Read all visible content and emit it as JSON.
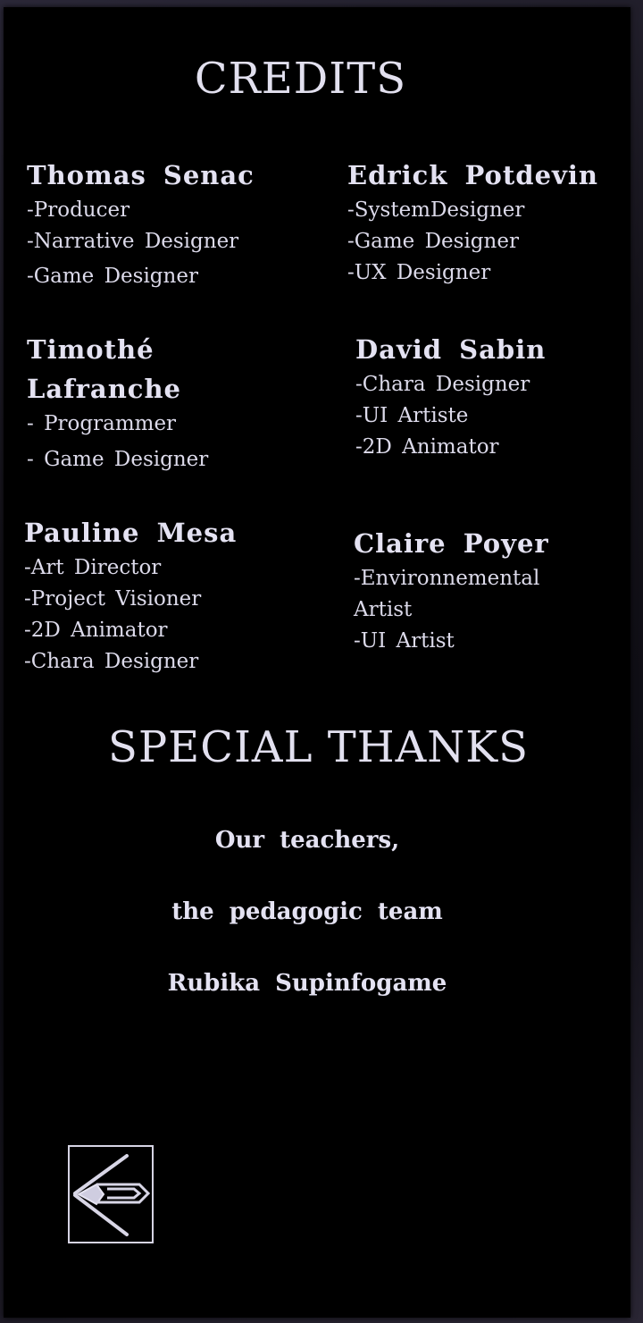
{
  "credits": {
    "title": "CREDITS",
    "members": [
      {
        "name": "Thomas Senac",
        "roles": [
          "-Producer",
          "-Narrative Designer",
          "-Game Designer"
        ]
      },
      {
        "name": "Edrick Potdevin",
        "roles": [
          "-SystemDesigner",
          "-Game Designer",
          "-UX Designer"
        ]
      },
      {
        "name": "Timothé\nLafranche",
        "roles": [
          "- Programmer",
          "- Game Designer"
        ]
      },
      {
        "name": "David Sabin",
        "roles": [
          "-Chara Designer",
          "-UI Artiste",
          "-2D Animator"
        ]
      },
      {
        "name": "Pauline Mesa",
        "roles": [
          "-Art Director",
          "-Project Visioner",
          "-2D Animator",
          "-Chara Designer"
        ]
      },
      {
        "name": "Claire Poyer",
        "roles": [
          "-Environnemental\nArtist",
          "-UI Artist"
        ]
      }
    ]
  },
  "special_thanks": {
    "title": "SPECIAL THANKS",
    "lines": [
      "Our teachers,",
      "the pedagogic team",
      "Rubika Supinfogame"
    ]
  },
  "back_button": {
    "icon": "back-arrow-icon"
  },
  "colors": {
    "panel": "#000000",
    "text": "#e4e2f2",
    "backdrop": "#1a1a24"
  }
}
